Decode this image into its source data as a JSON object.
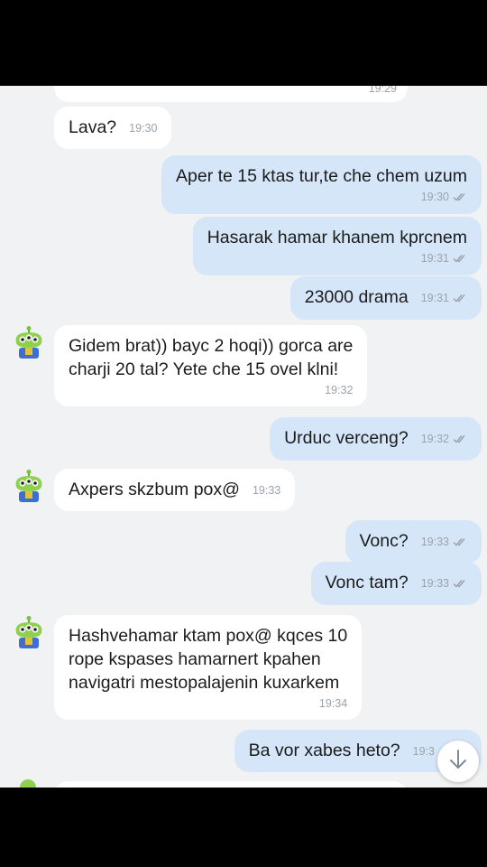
{
  "chat": {
    "partial_top": {
      "time": "19:29"
    },
    "messages": [
      {
        "id": "m1",
        "direction": "in",
        "lines": [
          "Lava?"
        ],
        "time": "19:30"
      },
      {
        "id": "m2",
        "direction": "out",
        "lines": [
          "Aper te 15 ktas tur,te che chem uzum"
        ],
        "time": "19:30",
        "status": "read"
      },
      {
        "id": "m3",
        "direction": "out",
        "lines": [
          "Hasarak hamar khanem kprcnem"
        ],
        "time": "19:31",
        "status": "read"
      },
      {
        "id": "m4",
        "direction": "out",
        "lines": [
          "23000 drama"
        ],
        "time": "19:31",
        "status": "read"
      },
      {
        "id": "m5",
        "direction": "in",
        "avatar": "alien-avatar",
        "lines": [
          "Gidem brat)) bayc 2 hoqi)) gorca are",
          "charji 20 tal? Yete che 15 ovel klni!"
        ],
        "time": "19:32"
      },
      {
        "id": "m6",
        "direction": "out",
        "lines": [
          "Urduc verceng?"
        ],
        "time": "19:32",
        "status": "read"
      },
      {
        "id": "m7",
        "direction": "in",
        "avatar": "alien-avatar",
        "lines": [
          "Axpers skzbum pox@"
        ],
        "time": "19:33"
      },
      {
        "id": "m8",
        "direction": "out",
        "lines": [
          "Vonc?"
        ],
        "time": "19:33",
        "status": "read"
      },
      {
        "id": "m9",
        "direction": "out",
        "lines": [
          "Vonc tam?"
        ],
        "time": "19:33",
        "status": "read"
      },
      {
        "id": "m10",
        "direction": "in",
        "avatar": "alien-avatar",
        "lines": [
          "Hashvehamar ktam pox@ kqces 10",
          "rope kspases hamarnert kpahen",
          "navigatri mestopalajenin kuxarkem"
        ],
        "time": "19:34"
      },
      {
        "id": "m11",
        "direction": "out",
        "lines": [
          "Ba vor xabes heto?"
        ],
        "time": "19:3",
        "status": "read"
      }
    ],
    "scroll_button": {
      "icon": "arrow-down-icon"
    }
  },
  "colors": {
    "chat_background": "#f1f2f4",
    "incoming_bubble": "#ffffff",
    "outgoing_bubble": "#d6e6f9",
    "timestamp": "#9aa3ad",
    "frame": "#000000"
  }
}
